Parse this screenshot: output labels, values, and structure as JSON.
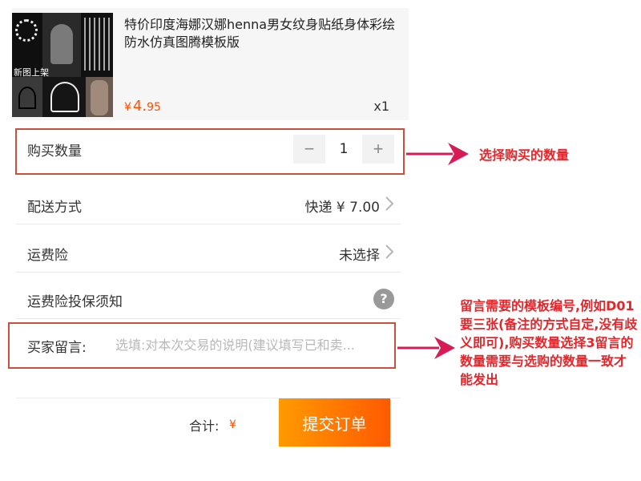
{
  "product": {
    "thumbnail_caption": "新图上架",
    "title": "特价印度海娜汉娜henna男女纹身贴纸身体彩绘防水仿真图腾模板版",
    "price_currency": "¥",
    "price_int": "4.",
    "price_cents": "95",
    "quantity": "x1"
  },
  "quantity_row": {
    "label": "购买数量",
    "minus": "−",
    "value": "1",
    "plus": "+"
  },
  "shipping_row": {
    "label": "配送方式",
    "value": "快递 ¥ 7.00"
  },
  "insurance_row": {
    "label": "运费险",
    "value": "未选择"
  },
  "insurance_notice_row": {
    "label": "运费险投保须知",
    "help": "?"
  },
  "message_row": {
    "label": "买家留言:",
    "placeholder": "选填:对本次交易的说明(建议填写已和卖...",
    "value": ""
  },
  "footer": {
    "total_label": "合计:",
    "total_currency": "¥",
    "submit_label": "提交订单"
  },
  "annotations": {
    "quantity_note": "选择购买的数量",
    "message_note": "留言需要的模板编号,例如D01要三张(备注的方式自定,没有歧义即可),购买数量选择3留言的数量需要与选购的数量一致才能发出"
  },
  "colors": {
    "accent": "#ff5000",
    "annotation_red": "#e3262b",
    "highlight_border": "#c9503c",
    "arrow": "#d81b55"
  }
}
